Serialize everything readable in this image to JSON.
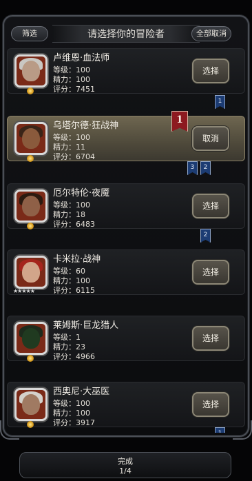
{
  "header": {
    "filter_label": "筛选",
    "title": "请选择你的冒险者",
    "deselect_all_label": "全部取消"
  },
  "adventurers": [
    {
      "name": "卢维恩·血法师",
      "level": "等级：100",
      "energy": "精力：100",
      "score": "评分：7451",
      "action": "选择",
      "selected": false,
      "portrait_colors": {
        "bg": "#7a2a18",
        "hair": "#c9c7c2",
        "face": "#b99b86"
      }
    },
    {
      "name": "乌塔尔德·狂战神",
      "level": "等级：100",
      "energy": "精力：11",
      "score": "评分：6704",
      "action": "取消",
      "selected": true,
      "marker": "1",
      "portrait_colors": {
        "bg": "#7a2a18",
        "hair": "#3a2418",
        "face": "#8a5a3c"
      }
    },
    {
      "name": "厄尔特伦·夜魇",
      "level": "等级：100",
      "energy": "精力：18",
      "score": "评分：6483",
      "action": "选择",
      "selected": false,
      "portrait_colors": {
        "bg": "#7a2a18",
        "hair": "#2c1a10",
        "face": "#8f6047"
      }
    },
    {
      "name": "卡米拉·战神",
      "level": "等级：60",
      "energy": "精力：100",
      "score": "评分：6115",
      "action": "选择",
      "selected": false,
      "stars": "★★★★★",
      "portrait_colors": {
        "bg": "#7a2a18",
        "hair": "#a5241c",
        "face": "#d2a58a"
      }
    },
    {
      "name": "莱姆斯·巨龙猎人",
      "level": "等级：1",
      "energy": "精力：23",
      "score": "评分：4966",
      "action": "选择",
      "selected": false,
      "portrait_colors": {
        "bg": "#7a2a18",
        "hair": "#1d2a1c",
        "face": "#203a20"
      }
    },
    {
      "name": "西奥尼·大巫医",
      "level": "等级：100",
      "energy": "精力：100",
      "score": "评分：3917",
      "action": "选择",
      "selected": false,
      "portrait_colors": {
        "bg": "#7a2a18",
        "hair": "#d4d1cb",
        "face": "#a07a62"
      }
    }
  ],
  "team_markers": {
    "after_card_1": [
      "1"
    ],
    "after_card_2": [
      "3",
      "2"
    ],
    "after_card_3": [
      "2"
    ],
    "after_card_6": [
      "1"
    ]
  },
  "footer": {
    "done_label": "完成",
    "page": "1/4"
  }
}
